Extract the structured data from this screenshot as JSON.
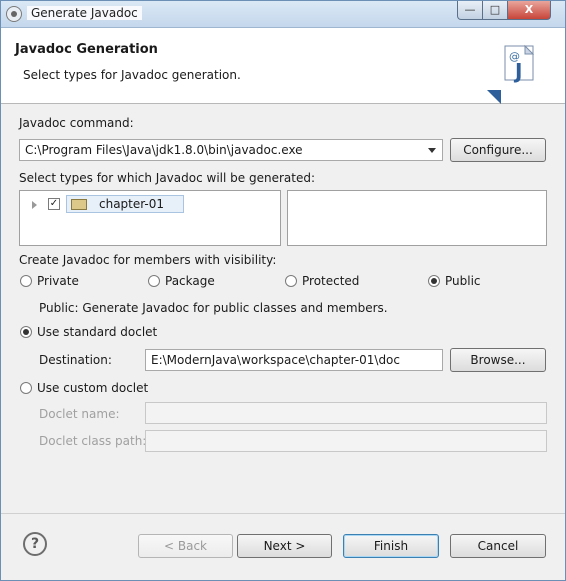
{
  "window": {
    "title": "Generate Javadoc",
    "min_label": "—",
    "max_label": "□",
    "close_label": "X"
  },
  "header": {
    "title": "Javadoc Generation",
    "description": "Select types for Javadoc generation.",
    "icon_letters": "@",
    "icon_j": "J"
  },
  "command": {
    "label": "Javadoc command:",
    "value": "C:\\Program Files\\Java\\jdk1.8.0\\bin\\javadoc.exe",
    "configure_button": "Configure..."
  },
  "types": {
    "label": "Select types for which Javadoc will be generated:",
    "tree_items": [
      {
        "label": "chapter-01",
        "checked": true
      }
    ]
  },
  "visibility": {
    "label": "Create Javadoc for members with visibility:",
    "options": [
      "Private",
      "Package",
      "Protected",
      "Public"
    ],
    "selected": "Public",
    "description": "Public: Generate Javadoc for public classes and members."
  },
  "doclet": {
    "standard_label": "Use standard doclet",
    "standard_selected": true,
    "destination_label": "Destination:",
    "destination_value": "E:\\ModernJava\\workspace\\chapter-01\\doc",
    "browse_button": "Browse...",
    "custom_label": "Use custom doclet",
    "doclet_name_label": "Doclet name:",
    "doclet_classpath_label": "Doclet class path:"
  },
  "footer": {
    "help_icon": "?",
    "back_button": "< Back",
    "next_button": "Next >",
    "finish_button": "Finish",
    "cancel_button": "Cancel"
  }
}
